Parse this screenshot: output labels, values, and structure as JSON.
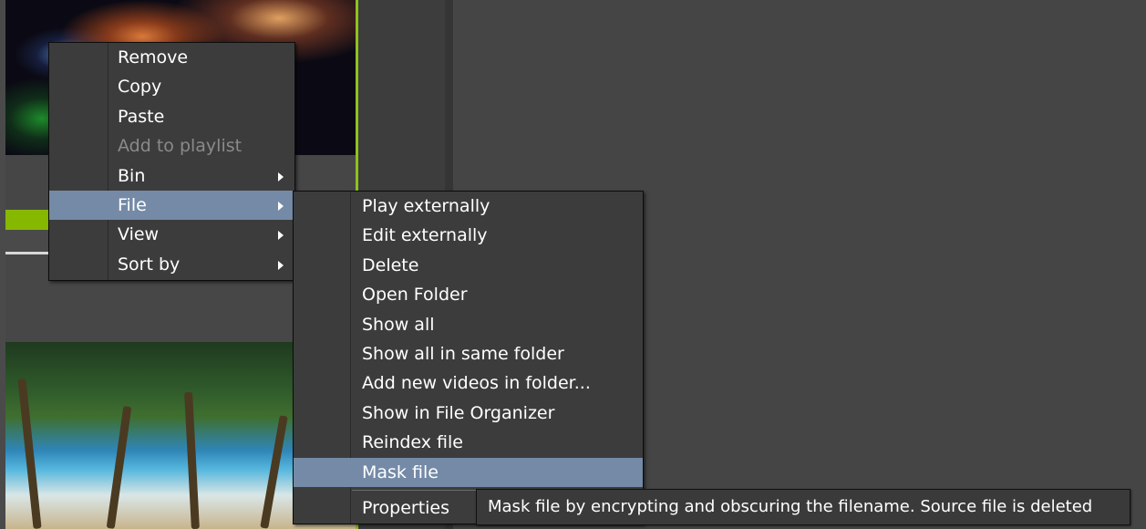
{
  "context_menu": {
    "items": [
      {
        "label": "Remove",
        "enabled": true
      },
      {
        "label": "Copy",
        "enabled": true
      },
      {
        "label": "Paste",
        "enabled": true
      },
      {
        "label": "Add to playlist",
        "enabled": false
      },
      {
        "label": "Bin",
        "enabled": true,
        "has_submenu": true
      },
      {
        "label": "File",
        "enabled": true,
        "has_submenu": true,
        "highlighted": true
      },
      {
        "label": "View",
        "enabled": true,
        "has_submenu": true
      },
      {
        "label": "Sort by",
        "enabled": true,
        "has_submenu": true
      }
    ]
  },
  "file_submenu": {
    "items": [
      {
        "label": "Play externally"
      },
      {
        "label": "Edit externally"
      },
      {
        "label": "Delete"
      },
      {
        "label": "Open Folder"
      },
      {
        "label": "Show all"
      },
      {
        "label": "Show all in same folder"
      },
      {
        "label": "Add new videos in folder..."
      },
      {
        "label": "Show in File Organizer"
      },
      {
        "label": "Reindex file"
      },
      {
        "label": "Mask file",
        "highlighted": true
      },
      {
        "label": "Properties"
      }
    ]
  },
  "tooltip": {
    "text": "Mask file by encrypting and obscuring the filename. Source file is deleted"
  },
  "colors": {
    "accent_green": "#8fc21c",
    "menu_highlight": "#748aa6",
    "menu_background": "#3c3c3c",
    "disabled_text": "#8a8a8a"
  }
}
